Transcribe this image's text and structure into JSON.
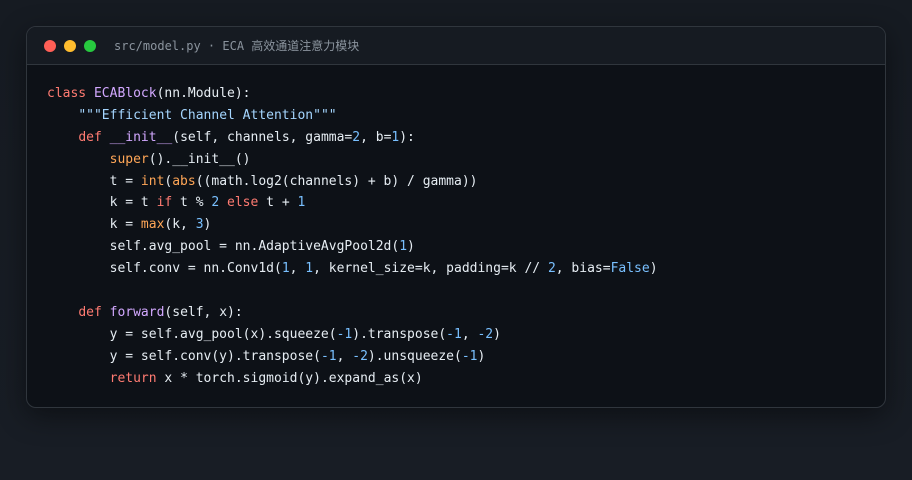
{
  "window": {
    "title": "src/model.py · ECA 高效通道注意力模块",
    "controls": [
      "close",
      "minimize",
      "maximize"
    ]
  },
  "colors": {
    "background": "#161b22",
    "editor_bg": "#0d1117",
    "keyword": "#ff7b72",
    "function": "#d2a8ff",
    "builtin": "#ffa657",
    "number": "#79c0ff",
    "string": "#a5d6ff",
    "text": "#e6edf3"
  },
  "code": {
    "language": "python",
    "lines": [
      [
        {
          "t": "class",
          "k": "kw"
        },
        {
          "t": " "
        },
        {
          "t": "ECABlock",
          "k": "fn"
        },
        {
          "t": "(nn.Module):"
        }
      ],
      [
        {
          "t": "    "
        },
        {
          "t": "\"\"\"Efficient Channel Attention\"\"\"",
          "k": "str"
        }
      ],
      [
        {
          "t": "    "
        },
        {
          "t": "def",
          "k": "kw"
        },
        {
          "t": " "
        },
        {
          "t": "__init__",
          "k": "fn"
        },
        {
          "t": "(self, channels, gamma="
        },
        {
          "t": "2",
          "k": "num"
        },
        {
          "t": ", b="
        },
        {
          "t": "1",
          "k": "num"
        },
        {
          "t": "):"
        }
      ],
      [
        {
          "t": "        "
        },
        {
          "t": "super",
          "k": "bi"
        },
        {
          "t": "().__init__()"
        }
      ],
      [
        {
          "t": "        t = "
        },
        {
          "t": "int",
          "k": "bi"
        },
        {
          "t": "("
        },
        {
          "t": "abs",
          "k": "bi"
        },
        {
          "t": "((math.log2(channels) + b) / gamma))"
        }
      ],
      [
        {
          "t": "        k = t "
        },
        {
          "t": "if",
          "k": "kw"
        },
        {
          "t": " t % "
        },
        {
          "t": "2",
          "k": "num"
        },
        {
          "t": " "
        },
        {
          "t": "else",
          "k": "kw"
        },
        {
          "t": " t + "
        },
        {
          "t": "1",
          "k": "num"
        }
      ],
      [
        {
          "t": "        k = "
        },
        {
          "t": "max",
          "k": "bi"
        },
        {
          "t": "(k, "
        },
        {
          "t": "3",
          "k": "num"
        },
        {
          "t": ")"
        }
      ],
      [
        {
          "t": "        self.avg_pool = nn.AdaptiveAvgPool2d("
        },
        {
          "t": "1",
          "k": "num"
        },
        {
          "t": ")"
        }
      ],
      [
        {
          "t": "        self.conv = nn.Conv1d("
        },
        {
          "t": "1",
          "k": "num"
        },
        {
          "t": ", "
        },
        {
          "t": "1",
          "k": "num"
        },
        {
          "t": ", kernel_size=k, padding=k // "
        },
        {
          "t": "2",
          "k": "num"
        },
        {
          "t": ", bias="
        },
        {
          "t": "False",
          "k": "num"
        },
        {
          "t": ")"
        }
      ],
      [],
      [
        {
          "t": "    "
        },
        {
          "t": "def",
          "k": "kw"
        },
        {
          "t": " "
        },
        {
          "t": "forward",
          "k": "fn"
        },
        {
          "t": "(self, x):"
        }
      ],
      [
        {
          "t": "        y = self.avg_pool(x).squeeze("
        },
        {
          "t": "-1",
          "k": "num"
        },
        {
          "t": ").transpose("
        },
        {
          "t": "-1",
          "k": "num"
        },
        {
          "t": ", "
        },
        {
          "t": "-2",
          "k": "num"
        },
        {
          "t": ")"
        }
      ],
      [
        {
          "t": "        y = self.conv(y).transpose("
        },
        {
          "t": "-1",
          "k": "num"
        },
        {
          "t": ", "
        },
        {
          "t": "-2",
          "k": "num"
        },
        {
          "t": ").unsqueeze("
        },
        {
          "t": "-1",
          "k": "num"
        },
        {
          "t": ")"
        }
      ],
      [
        {
          "t": "        "
        },
        {
          "t": "return",
          "k": "kw"
        },
        {
          "t": " x * torch.sigmoid(y).expand_as(x)"
        }
      ]
    ]
  }
}
